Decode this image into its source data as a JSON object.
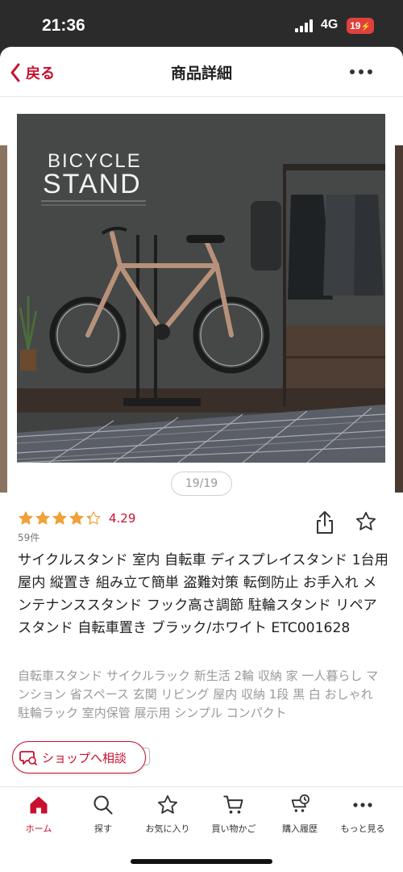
{
  "status": {
    "time": "21:36",
    "network": "4G",
    "battery": "19"
  },
  "nav": {
    "back_label": "戻る",
    "title": "商品詳細"
  },
  "gallery": {
    "image_title_line1": "BICYCLE",
    "image_title_line2": "STAND",
    "counter": "19/19"
  },
  "product": {
    "rating_value": "4.29",
    "rating_stars": 4.29,
    "review_count": "59件",
    "title": "サイクルスタンド 室内 自転車 ディスプレイスタンド 1台用 屋内 縦置き 組み立て簡単 盗難対策 転倒防止 お手入れ メンテナンススタンド フック高さ調節 駐輪スタンド リペアスタンド 自転車置き ブラック/ホワイト ETC001628",
    "tags": "自転車スタンド サイクルラック 新生活 2輪 収納 家 一人暮らし マンション 省スペース 玄関 リビング 屋内 収納 1段 黒 白 おしゃれ 駐輪ラック 室内保管 展示用 シンプル コンパクト"
  },
  "consult_button": "ショップへ相談",
  "tabs": [
    {
      "label": "ホーム",
      "icon": "home-icon",
      "active": true
    },
    {
      "label": "探す",
      "icon": "search-icon",
      "active": false
    },
    {
      "label": "お気に入り",
      "icon": "star-icon",
      "active": false
    },
    {
      "label": "買い物かご",
      "icon": "cart-icon",
      "active": false
    },
    {
      "label": "購入履歴",
      "icon": "history-icon",
      "active": false
    },
    {
      "label": "もっと見る",
      "icon": "more-icon",
      "active": false
    }
  ],
  "colors": {
    "accent": "#c8102e",
    "star": "#f0a13a"
  }
}
